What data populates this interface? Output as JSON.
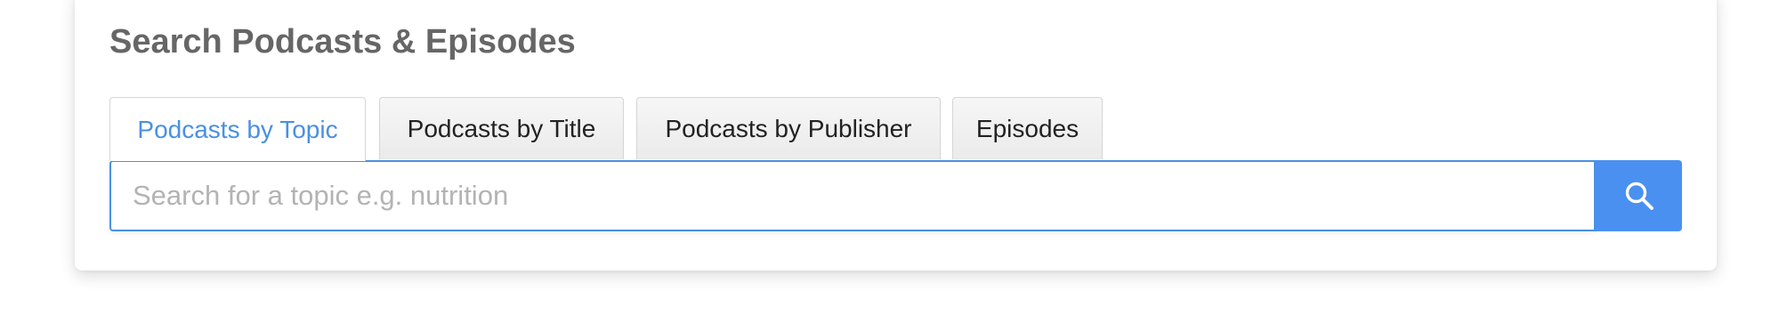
{
  "section": {
    "title": "Search Podcasts & Episodes"
  },
  "tabs": [
    {
      "label": "Podcasts by Topic",
      "active": true
    },
    {
      "label": "Podcasts by Title",
      "active": false
    },
    {
      "label": "Podcasts by Publisher",
      "active": false
    },
    {
      "label": "Episodes",
      "active": false
    }
  ],
  "search": {
    "value": "",
    "placeholder": "Search for a topic e.g. nutrition",
    "button_icon": "search-icon"
  },
  "colors": {
    "accent": "#4a90e2",
    "button": "#4a90f0",
    "title": "#666666"
  }
}
